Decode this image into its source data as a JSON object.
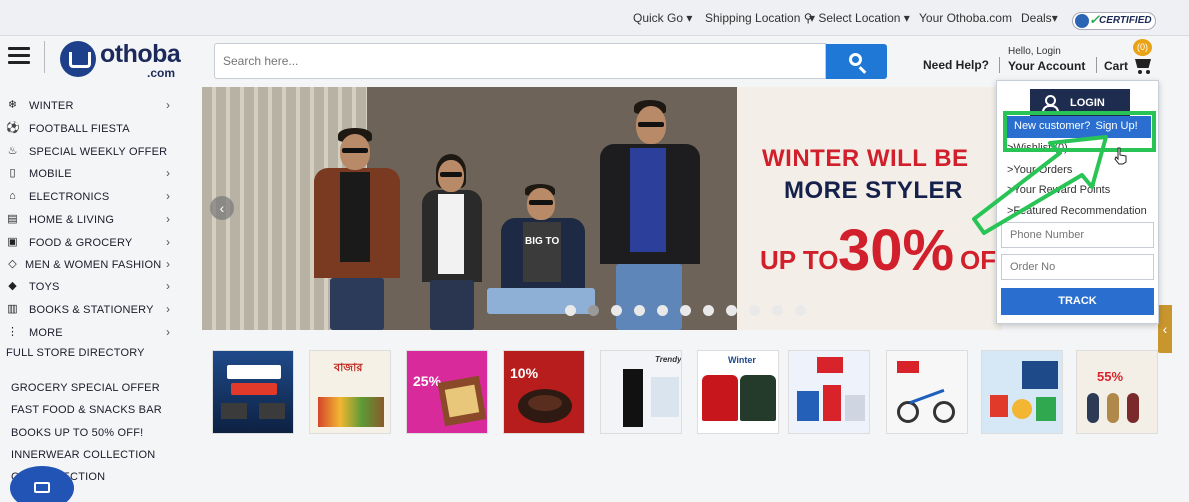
{
  "topbar": {
    "quick_go": "Quick Go",
    "shipping_location": "Shipping Location",
    "select_location": "Select Location",
    "your_othoba": "Your Othoba.com",
    "deals": "Deals",
    "certified": "CERTIFIED"
  },
  "header": {
    "logo_text": "othoba",
    "logo_suffix": ".com",
    "search_placeholder": "Search here...",
    "need_help": "Need Help?",
    "hello_login": "Hello, Login",
    "your_account": "Your Account",
    "cart_label": "Cart",
    "cart_count": "(0)"
  },
  "sidebar": {
    "categories": [
      {
        "label": "WINTER",
        "icon": "snowflake-icon"
      },
      {
        "label": "FOOTBALL FIESTA",
        "icon": "football-icon"
      },
      {
        "label": "SPECIAL WEEKLY OFFER",
        "icon": "offer-icon"
      },
      {
        "label": "MOBILE",
        "icon": "mobile-icon"
      },
      {
        "label": "ELECTRONICS",
        "icon": "electronics-icon"
      },
      {
        "label": "HOME & LIVING",
        "icon": "home-icon"
      },
      {
        "label": "FOOD & GROCERY",
        "icon": "food-icon"
      },
      {
        "label": "MEN & WOMEN FASHION",
        "icon": "fashion-icon"
      },
      {
        "label": "TOYS",
        "icon": "toys-icon"
      },
      {
        "label": "BOOKS & STATIONERY",
        "icon": "books-icon"
      },
      {
        "label": "MORE",
        "icon": "more-icon"
      }
    ],
    "directory": "FULL STORE DIRECTORY",
    "promos": [
      "GROCERY SPECIAL OFFER",
      "FAST FOOD & SNACKS BAR",
      "BOOKS UP TO 50% OFF!",
      "INNERWEAR COLLECTION",
      "CO     PROTECTION"
    ]
  },
  "hero": {
    "line1": "WINTER WILL BE",
    "line2": "MORE STYLER",
    "up_to": "UP TO",
    "percent": "30%",
    "off": "OFF",
    "tshirt_text": "BIG TO",
    "slides": 11,
    "active_slide": 1
  },
  "account_dropdown": {
    "login": "LOGIN",
    "new_customer": "New customer?",
    "sign_up": "Sign Up!",
    "wishlist": ">Wishlist (0)",
    "your_orders": ">Your Orders",
    "reward_points": ">Your Reward Points",
    "featured": ">Featured Recommendation",
    "phone_placeholder": "Phone Number",
    "order_placeholder": "Order No",
    "track": "TRACK"
  },
  "tiles": [
    {
      "name": "tile-offer-banner",
      "text": ""
    },
    {
      "name": "tile-bakery",
      "text": "বাজার"
    },
    {
      "name": "tile-25-off",
      "text": "25%"
    },
    {
      "name": "tile-cake",
      "text": "10%"
    },
    {
      "name": "tile-trendy",
      "text": "Trendy"
    },
    {
      "name": "tile-winter-jackets",
      "text": "Winter"
    },
    {
      "name": "tile-household",
      "text": ""
    },
    {
      "name": "tile-bicycle",
      "text": ""
    },
    {
      "name": "tile-toys",
      "text": ""
    },
    {
      "name": "tile-watches",
      "text": "55%"
    }
  ],
  "colors": {
    "accent_blue": "#1f78d6",
    "brand_navy": "#1b2a5a",
    "highlight_green": "#29c456",
    "sale_red": "#d11f2b",
    "badge_orange": "#e8a317"
  }
}
